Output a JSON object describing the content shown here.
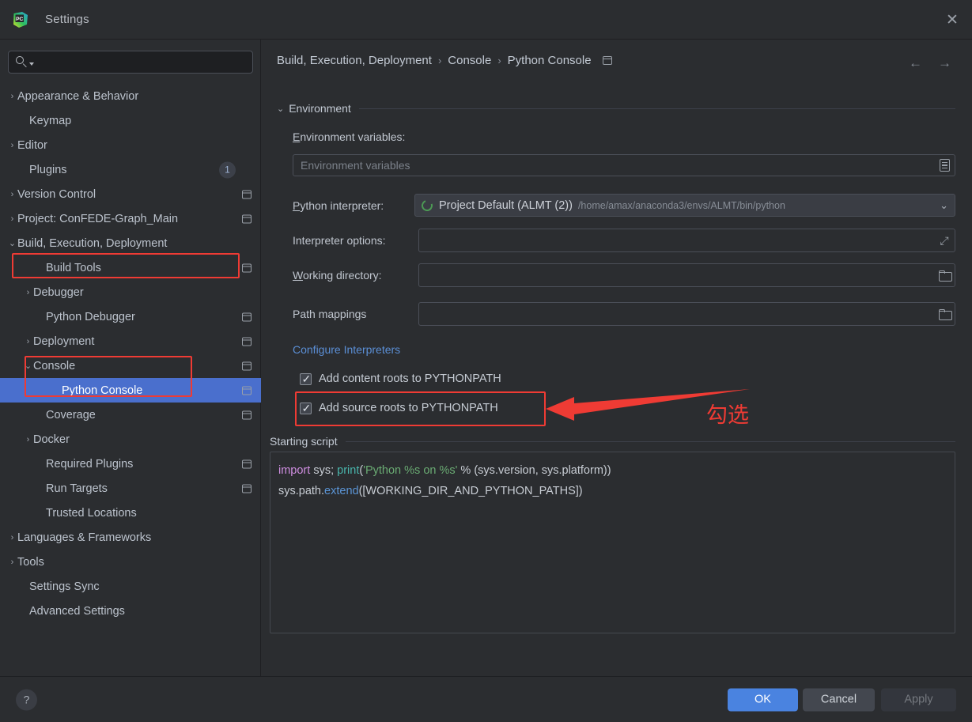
{
  "window": {
    "title": "Settings",
    "logo_text": "PC",
    "close_icon": "✕"
  },
  "sidebar": {
    "search": {
      "placeholder": "",
      "value": ""
    },
    "items": [
      {
        "label": "Appearance & Behavior",
        "arrow": "›",
        "indent": 22,
        "bold": true,
        "scope": false,
        "badge": null,
        "selected": false
      },
      {
        "label": "Keymap",
        "arrow": "",
        "indent": 37,
        "bold": true,
        "scope": false,
        "badge": null,
        "selected": false
      },
      {
        "label": "Editor",
        "arrow": "›",
        "indent": 22,
        "bold": true,
        "scope": false,
        "badge": null,
        "selected": false
      },
      {
        "label": "Plugins",
        "arrow": "",
        "indent": 37,
        "bold": true,
        "scope": false,
        "badge": "1",
        "selected": false
      },
      {
        "label": "Version Control",
        "arrow": "›",
        "indent": 22,
        "bold": true,
        "scope": true,
        "badge": null,
        "selected": false
      },
      {
        "label": "Project: ConFEDE-Graph_Main",
        "arrow": "›",
        "indent": 22,
        "bold": true,
        "scope": true,
        "badge": null,
        "selected": false
      },
      {
        "label": "Build, Execution, Deployment",
        "arrow": "⌄",
        "indent": 22,
        "bold": true,
        "scope": false,
        "badge": null,
        "selected": false
      },
      {
        "label": "Build Tools",
        "arrow": "",
        "indent": 58,
        "bold": false,
        "scope": true,
        "badge": null,
        "selected": false
      },
      {
        "label": "Debugger",
        "arrow": "›",
        "indent": 42,
        "bold": false,
        "scope": false,
        "badge": null,
        "selected": false
      },
      {
        "label": "Python Debugger",
        "arrow": "",
        "indent": 58,
        "bold": false,
        "scope": true,
        "badge": null,
        "selected": false
      },
      {
        "label": "Deployment",
        "arrow": "›",
        "indent": 42,
        "bold": false,
        "scope": true,
        "badge": null,
        "selected": false
      },
      {
        "label": "Console",
        "arrow": "⌄",
        "indent": 42,
        "bold": false,
        "scope": true,
        "badge": null,
        "selected": false
      },
      {
        "label": "Python Console",
        "arrow": "",
        "indent": 78,
        "bold": false,
        "scope": true,
        "badge": null,
        "selected": true
      },
      {
        "label": "Coverage",
        "arrow": "",
        "indent": 58,
        "bold": false,
        "scope": true,
        "badge": null,
        "selected": false
      },
      {
        "label": "Docker",
        "arrow": "›",
        "indent": 42,
        "bold": false,
        "scope": false,
        "badge": null,
        "selected": false
      },
      {
        "label": "Required Plugins",
        "arrow": "",
        "indent": 58,
        "bold": false,
        "scope": true,
        "badge": null,
        "selected": false
      },
      {
        "label": "Run Targets",
        "arrow": "",
        "indent": 58,
        "bold": false,
        "scope": true,
        "badge": null,
        "selected": false
      },
      {
        "label": "Trusted Locations",
        "arrow": "",
        "indent": 58,
        "bold": false,
        "scope": false,
        "badge": null,
        "selected": false
      },
      {
        "label": "Languages & Frameworks",
        "arrow": "›",
        "indent": 22,
        "bold": true,
        "scope": false,
        "badge": null,
        "selected": false
      },
      {
        "label": "Tools",
        "arrow": "›",
        "indent": 22,
        "bold": true,
        "scope": false,
        "badge": null,
        "selected": false
      },
      {
        "label": "Settings Sync",
        "arrow": "",
        "indent": 37,
        "bold": true,
        "scope": false,
        "badge": null,
        "selected": false
      },
      {
        "label": "Advanced Settings",
        "arrow": "",
        "indent": 37,
        "bold": true,
        "scope": false,
        "badge": null,
        "selected": false
      }
    ]
  },
  "breadcrumb": {
    "parts": [
      "Build, Execution, Deployment",
      "Console",
      "Python Console"
    ],
    "separator": "›",
    "back_icon": "←",
    "forward_icon": "→"
  },
  "main": {
    "environment_section": {
      "title": "Environment",
      "chevron": "⌄"
    },
    "env_vars": {
      "label": "Environment variables:",
      "label_mnemonic": "E",
      "label_rest": "nvironment variables:",
      "placeholder": "Environment variables",
      "value": ""
    },
    "interpreter": {
      "label": "Python interpreter:",
      "label_mnemonic": "P",
      "label_rest": "ython interpreter:",
      "selected": "Project Default (ALMT (2))",
      "path": "/home/amax/anaconda3/envs/ALMT/bin/python",
      "chevron": "⌄"
    },
    "interpreter_options": {
      "label": "Interpreter options:",
      "value": ""
    },
    "working_directory": {
      "label": "Working directory:",
      "label_mnemonic": "W",
      "label_rest": "orking directory:",
      "value": ""
    },
    "path_mappings": {
      "label": "Path mappings",
      "value": ""
    },
    "configure_link": "Configure Interpreters",
    "checkboxes": [
      {
        "label": "Add content roots to PYTHONPATH",
        "checked": true
      },
      {
        "label": "Add source roots to PYTHONPATH",
        "checked": true
      }
    ],
    "starting_script": {
      "title": "Starting script",
      "lines": [
        [
          {
            "t": "import",
            "c": "kw"
          },
          {
            "t": " sys; ",
            "c": ""
          },
          {
            "t": "print",
            "c": "fn"
          },
          {
            "t": "(",
            "c": ""
          },
          {
            "t": "'Python %s on %s'",
            "c": "str"
          },
          {
            "t": " % (sys.version, sys.platform))",
            "c": ""
          }
        ],
        [
          {
            "t": "sys.path.",
            "c": ""
          },
          {
            "t": "extend",
            "c": "meth"
          },
          {
            "t": "([WORKING_DIR_AND_PYTHON_PATHS])",
            "c": ""
          }
        ]
      ]
    }
  },
  "footer": {
    "help_icon": "?",
    "ok": "OK",
    "cancel": "Cancel",
    "apply": "Apply"
  },
  "annotations": {
    "note_text": "勾选",
    "color": "#ef3b34"
  }
}
